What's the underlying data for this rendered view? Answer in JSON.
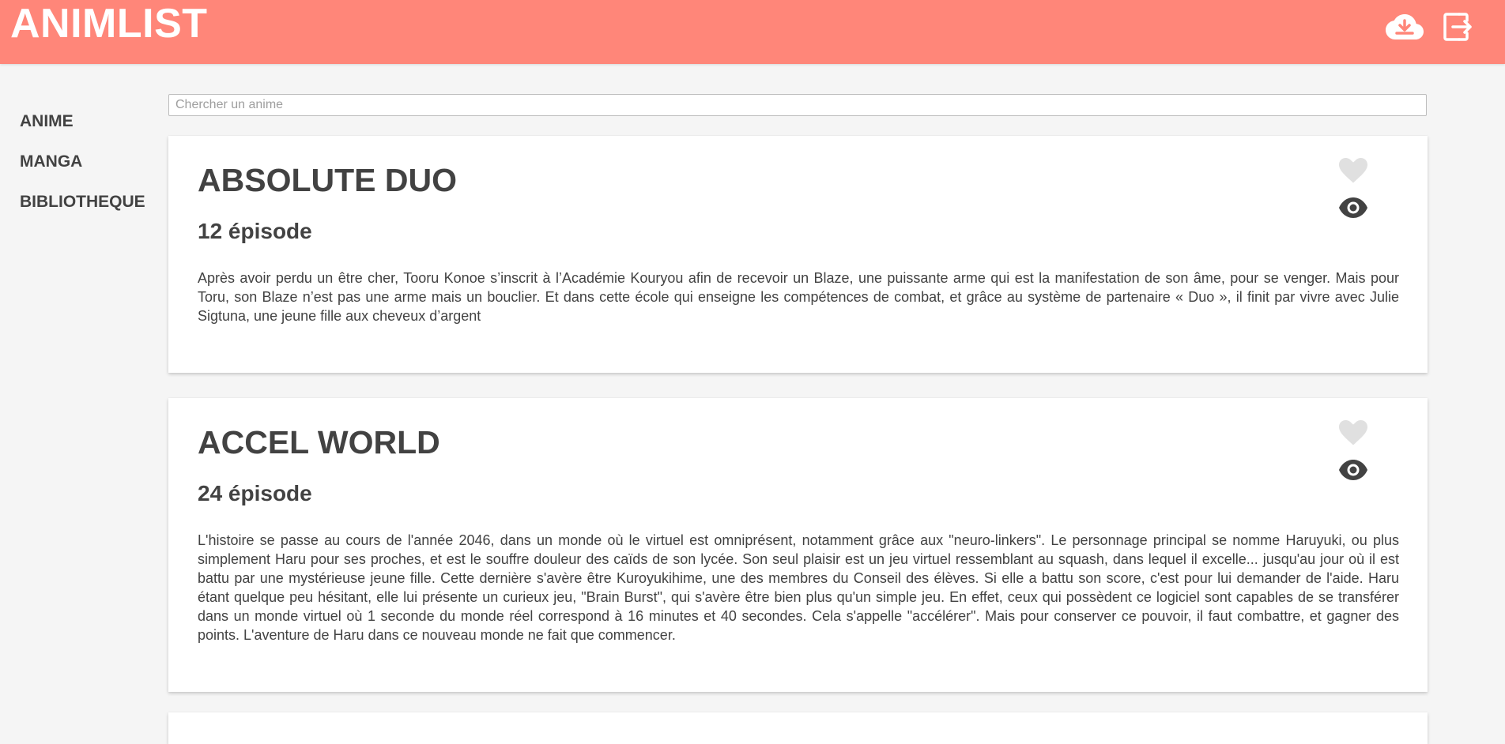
{
  "app": {
    "title": "ANIMLIST"
  },
  "header": {
    "icons": [
      "cloud-download-icon",
      "logout-icon"
    ]
  },
  "sidebar": {
    "items": [
      {
        "label": "ANIME"
      },
      {
        "label": "MANGA"
      },
      {
        "label": "BIBLIOTHEQUE"
      }
    ]
  },
  "search": {
    "placeholder": "Chercher un anime",
    "value": ""
  },
  "anime": [
    {
      "title": "ABSOLUTE DUO",
      "episodes": "12 épisode",
      "description": "Après avoir perdu un être cher, Tooru Konoe s’inscrit à l’Académie Kouryou afin de recevoir un Blaze, une puissante arme qui est la manifestation de son âme, pour se venger. Mais pour Toru, son Blaze n’est pas une arme mais un bouclier. Et dans cette école qui enseigne les compétences de combat, et grâce au système de partenaire « Duo », il finit par vivre avec Julie Sigtuna, une jeune fille aux cheveux d’argent"
    },
    {
      "title": "ACCEL WORLD",
      "episodes": "24 épisode",
      "description": "L'histoire se passe au cours de l'année 2046, dans un monde où le virtuel est omniprésent, notamment grâce aux \"neuro-linkers\". Le personnage principal se nomme Haruyuki, ou plus simplement Haru pour ses proches, et est le souffre douleur des caïds de son lycée. Son seul plaisir est un jeu virtuel ressemblant au squash, dans lequel il excelle... jusqu'au jour où il est battu par une mystérieuse jeune fille. Cette dernière s'avère être Kuroyukihime, une des membres du Conseil des élèves. Si elle a battu son score, c'est pour lui demander de l'aide. Haru étant quelque peu hésitant, elle lui présente un curieux jeu, \"Brain Burst\", qui s'avère être bien plus qu'un simple jeu. En effet, ceux qui possèdent ce logiciel sont capables de se transférer dans un monde virtuel où 1 seconde du monde réel correspond à 16 minutes et 40 secondes. Cela s'appelle \"accélérer\". Mais pour conserver ce pouvoir, il faut combattre, et gagner des points. L'aventure de Haru dans ce nouveau monde ne fait que commencer."
    }
  ],
  "colors": {
    "header": "#ff8679",
    "background": "#f5f5f5",
    "text": "#424242",
    "heart_inactive": "#e0e0e0"
  }
}
